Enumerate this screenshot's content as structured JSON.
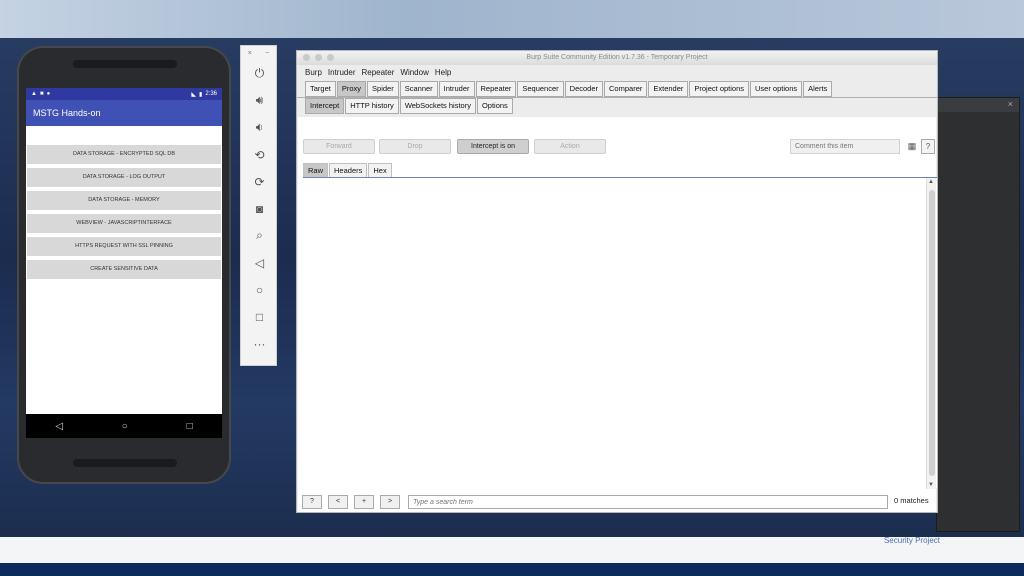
{
  "phone": {
    "status_time": "2:36",
    "app_title": "MSTG Hands-on",
    "buttons": [
      "DATA STORAGE - ENCRYPTED SQL DB",
      "DATA STORAGE - LOG OUTPUT",
      "DATA STORAGE - MEMORY",
      "WEBVIEW - JAVASCRIPTINTERFACE",
      "HTTPS REQUEST WITH SSL PINNING",
      "CREATE SENSITIVE DATA"
    ],
    "nav": {
      "back": "◁",
      "home": "○",
      "recents": "□"
    }
  },
  "emulator": {
    "controls": [
      "×",
      "−"
    ],
    "icons": [
      "power-icon",
      "volume-up-icon",
      "volume-down-icon",
      "rotate-left-icon",
      "rotate-right-icon",
      "camera-icon",
      "zoom-icon",
      "back-icon",
      "home-icon",
      "overview-icon",
      "more-icon"
    ],
    "more": "···"
  },
  "burp": {
    "title": "Burp Suite Community Edition v1.7.36 - Temporary Project",
    "menu": [
      "Burp",
      "Intruder",
      "Repeater",
      "Window",
      "Help"
    ],
    "main_tabs": [
      "Target",
      "Proxy",
      "Spider",
      "Scanner",
      "Intruder",
      "Repeater",
      "Sequencer",
      "Decoder",
      "Comparer",
      "Extender",
      "Project options",
      "User options",
      "Alerts"
    ],
    "proxy_tabs": [
      "Intercept",
      "HTTP history",
      "WebSockets history",
      "Options"
    ],
    "actions": {
      "forward": "Forward",
      "drop": "Drop",
      "intercept": "Intercept is on",
      "action": "Action",
      "comment_placeholder": "Comment this item",
      "help": "?"
    },
    "message_tabs": [
      "Raw",
      "Headers",
      "Hex"
    ],
    "bottom": {
      "help": "?",
      "prev": "<",
      "next": "+",
      "last": ">",
      "search_placeholder": "Type a search term",
      "matches": "0 matches"
    }
  },
  "footer": {
    "text": "Security Project"
  }
}
